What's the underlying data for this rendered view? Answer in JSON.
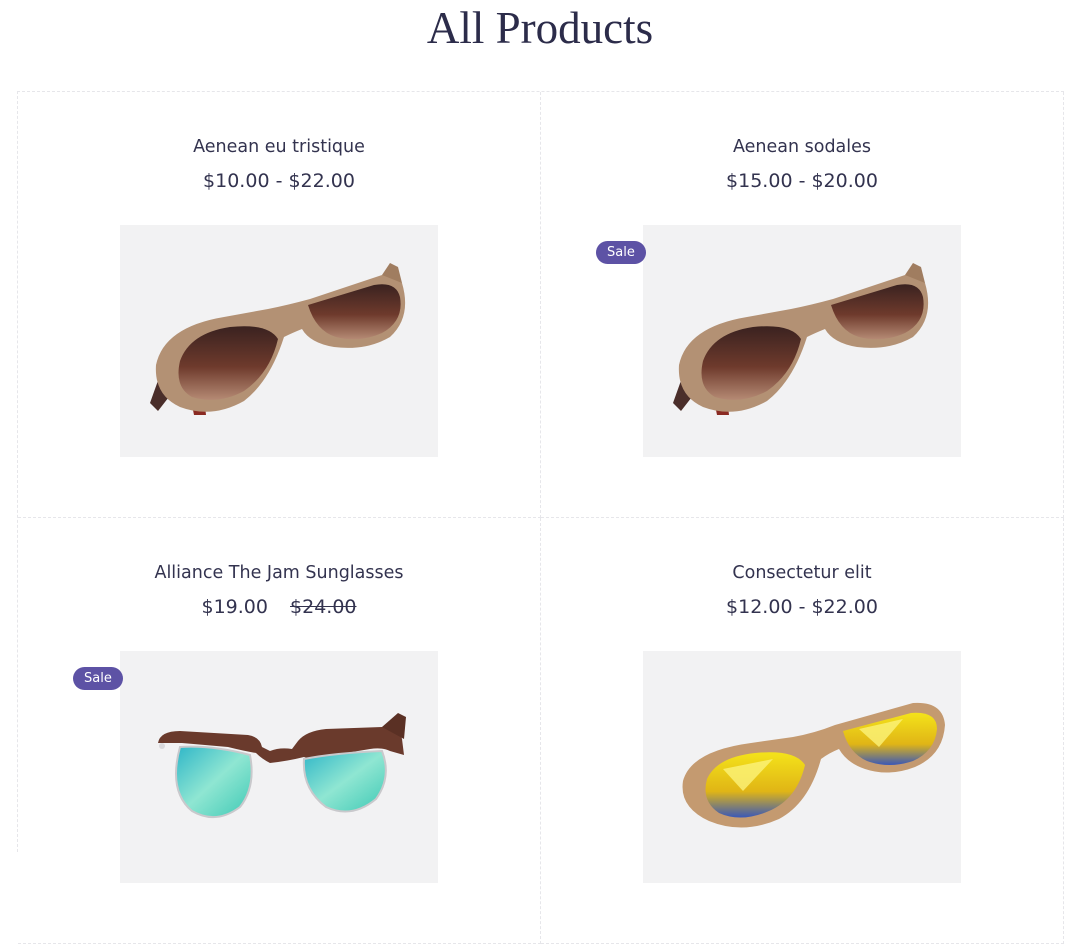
{
  "page": {
    "title": "All Products"
  },
  "badge": {
    "sale": "Sale"
  },
  "products": [
    {
      "name": "Aenean eu tristique",
      "price": "$10.00 - $22.00",
      "image": "wooden-sunglasses-brown-lens-icon"
    },
    {
      "name": "Aenean sodales",
      "price": "$15.00 - $20.00",
      "image": "wooden-sunglasses-brown-lens-icon",
      "sale": true
    },
    {
      "name": "Alliance The Jam Sunglasses",
      "price": "$19.00",
      "old_price": "$24.00",
      "image": "clubmaster-sunglasses-mirror-blue-icon",
      "sale": true
    },
    {
      "name": "Consectetur elit",
      "price": "$12.00 - $22.00",
      "image": "cork-sunglasses-mirror-yellow-icon"
    }
  ],
  "colors": {
    "title": "#2c2c4a",
    "sale_badge": "#5d52a5",
    "image_bg": "#f2f2f3"
  }
}
